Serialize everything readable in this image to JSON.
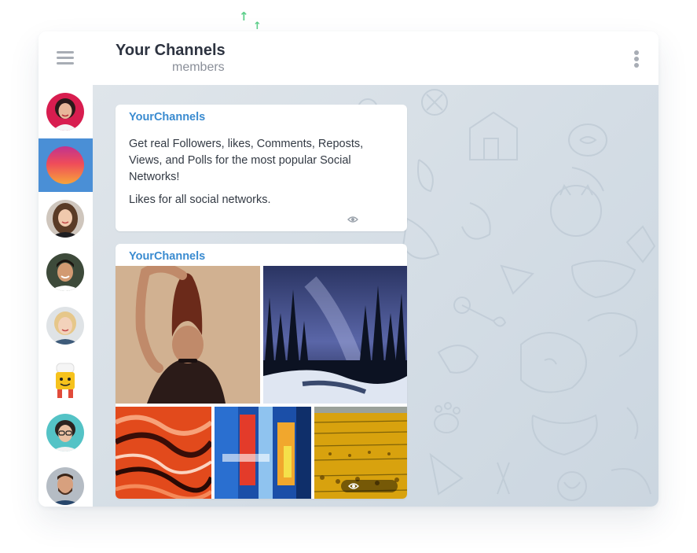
{
  "header": {
    "title": "Your Channels",
    "subtitle": "members"
  },
  "sidebar": {
    "chats": [
      {
        "name": "avatar-woman-red",
        "active": false
      },
      {
        "name": "avatar-gradient",
        "active": true
      },
      {
        "name": "avatar-woman-brunette",
        "active": false
      },
      {
        "name": "avatar-man-dark-hair",
        "active": false
      },
      {
        "name": "avatar-woman-blonde",
        "active": false
      },
      {
        "name": "avatar-toy-chef",
        "active": false
      },
      {
        "name": "avatar-woman-glasses",
        "active": false
      },
      {
        "name": "avatar-man-bearded",
        "active": false
      }
    ]
  },
  "messages": [
    {
      "sender": "YourChannels",
      "paragraphs": [
        "Get real Followers, likes, Comments, Reposts, Views, and Polls for the most popular Social Networks!",
        "Likes for all social networks."
      ]
    },
    {
      "sender": "YourChannels",
      "photos": [
        "woman-portrait",
        "snowy-forest-night",
        "abstract-orange-waves",
        "abstract-blue-paint",
        "sunflower-field"
      ]
    }
  ],
  "colors": {
    "accent": "#4a8fd6",
    "sender": "#3a8bd0",
    "arrows": "#5ccf8a"
  },
  "icons": {
    "menu": "hamburger-icon",
    "more": "kebab-icon",
    "views": "eye-icon"
  }
}
